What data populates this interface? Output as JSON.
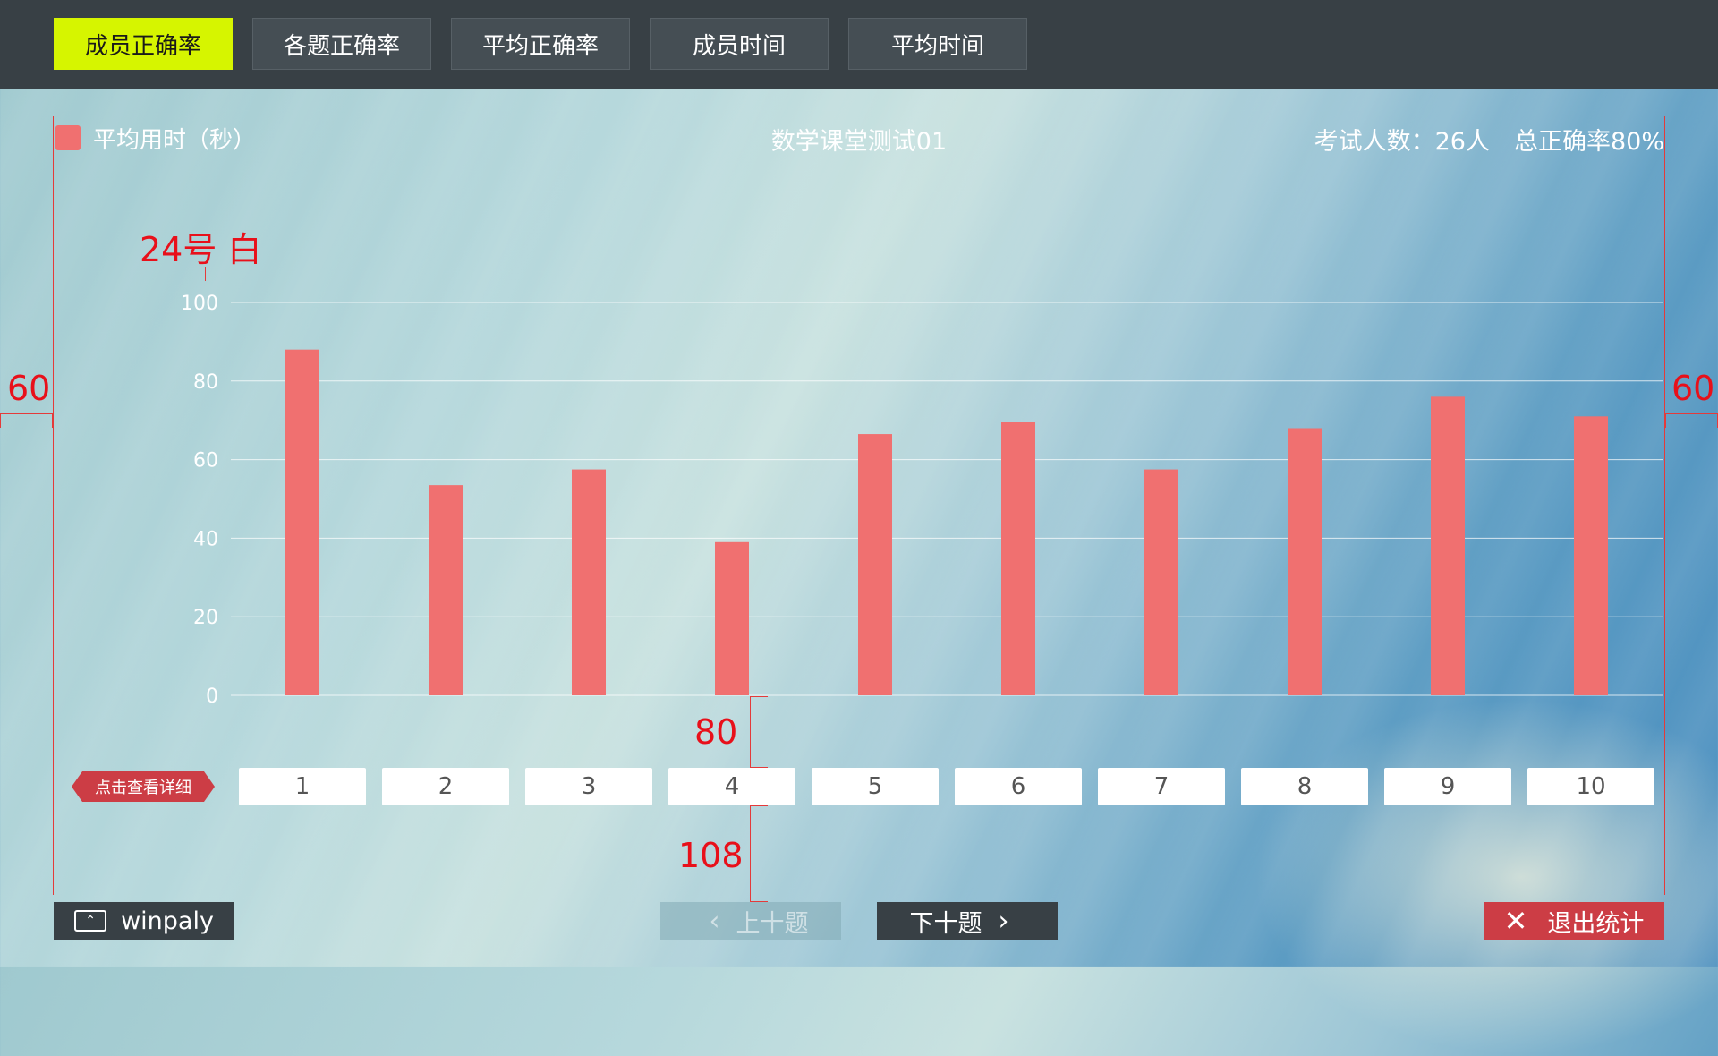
{
  "tabs": [
    {
      "label": "成员正确率",
      "active": true
    },
    {
      "label": "各题正确率",
      "active": false
    },
    {
      "label": "平均正确率",
      "active": false
    },
    {
      "label": "成员时间",
      "active": false
    },
    {
      "label": "平均时间",
      "active": false
    }
  ],
  "header": {
    "legend_label": "平均用时（秒）",
    "title": "数学课堂测试01",
    "summary": "考试人数：26人　总正确率80%"
  },
  "annotations": {
    "font_note": "24号  白",
    "left_margin": "60",
    "right_margin": "60",
    "gap_top": "80",
    "gap_bottom": "108"
  },
  "chart_data": {
    "type": "bar",
    "categories": [
      "1",
      "2",
      "3",
      "4",
      "5",
      "6",
      "7",
      "8",
      "9",
      "10"
    ],
    "values": [
      88,
      53.5,
      57.5,
      39,
      66.5,
      69.5,
      57.5,
      68,
      76,
      71
    ],
    "ylim": [
      0,
      100
    ],
    "yticks": [
      0,
      20,
      40,
      60,
      80,
      100
    ],
    "legend": "平均用时（秒）",
    "grid": true,
    "bar_color": "#f07070"
  },
  "detail_tag": "点击查看详细",
  "questions": [
    "1",
    "2",
    "3",
    "4",
    "5",
    "6",
    "7",
    "8",
    "9",
    "10"
  ],
  "buttons": {
    "winpaly": "winpaly",
    "prev": "上十题",
    "next": "下十题",
    "exit": "退出统计"
  },
  "colors": {
    "accent_tab": "#d6f500",
    "bar": "#f07070",
    "exit": "#cc3d45",
    "annotation": "#e8101a"
  }
}
